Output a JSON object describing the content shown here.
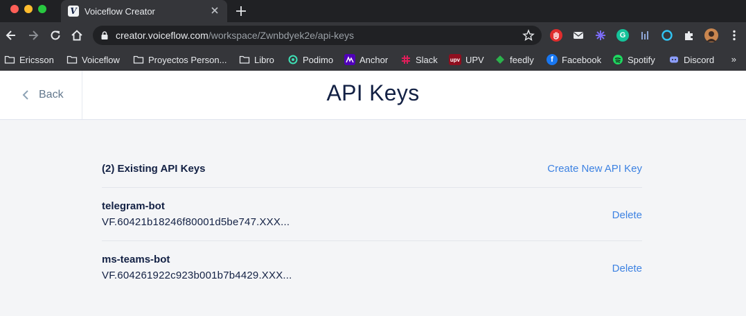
{
  "browser": {
    "tab_title": "Voiceflow Creator",
    "tab_favicon_letter": "V",
    "url_host": "creator.voiceflow.com",
    "url_path": "/workspace/Zwnbdyek2e/api-keys",
    "bookmarks": [
      {
        "label": "Ericsson",
        "icon": "folder-icon"
      },
      {
        "label": "Voiceflow",
        "icon": "folder-icon"
      },
      {
        "label": "Proyectos Person...",
        "icon": "folder-icon"
      },
      {
        "label": "Libro",
        "icon": "folder-icon"
      },
      {
        "label": "Podimo",
        "icon": "podimo-icon"
      },
      {
        "label": "Anchor",
        "icon": "anchor-icon"
      },
      {
        "label": "Slack",
        "icon": "slack-icon"
      },
      {
        "label": "UPV",
        "icon": "upv-icon",
        "icon_text": "upv"
      },
      {
        "label": "feedly",
        "icon": "feedly-icon"
      },
      {
        "label": "Facebook",
        "icon": "facebook-icon",
        "icon_text": "f"
      },
      {
        "label": "Spotify",
        "icon": "spotify-icon"
      },
      {
        "label": "Discord",
        "icon": "discord-icon"
      }
    ],
    "bookmarks_more": "»",
    "extension_badges": {
      "grammarly": "G"
    }
  },
  "header": {
    "back_label": "Back",
    "title": "API Keys"
  },
  "api_keys": {
    "count_label": "(2) Existing API Keys",
    "create_label": "Create New API Key",
    "delete_label": "Delete",
    "items": [
      {
        "name": "telegram-bot",
        "key": "VF.60421b18246f80001d5be747.XXX..."
      },
      {
        "name": "ms-teams-bot",
        "key": "VF.604261922c923b001b7b4429.XXX..."
      }
    ]
  },
  "colors": {
    "accent_link": "#3d82e2",
    "title_text": "#132144",
    "page_background": "#f4f5f7"
  }
}
